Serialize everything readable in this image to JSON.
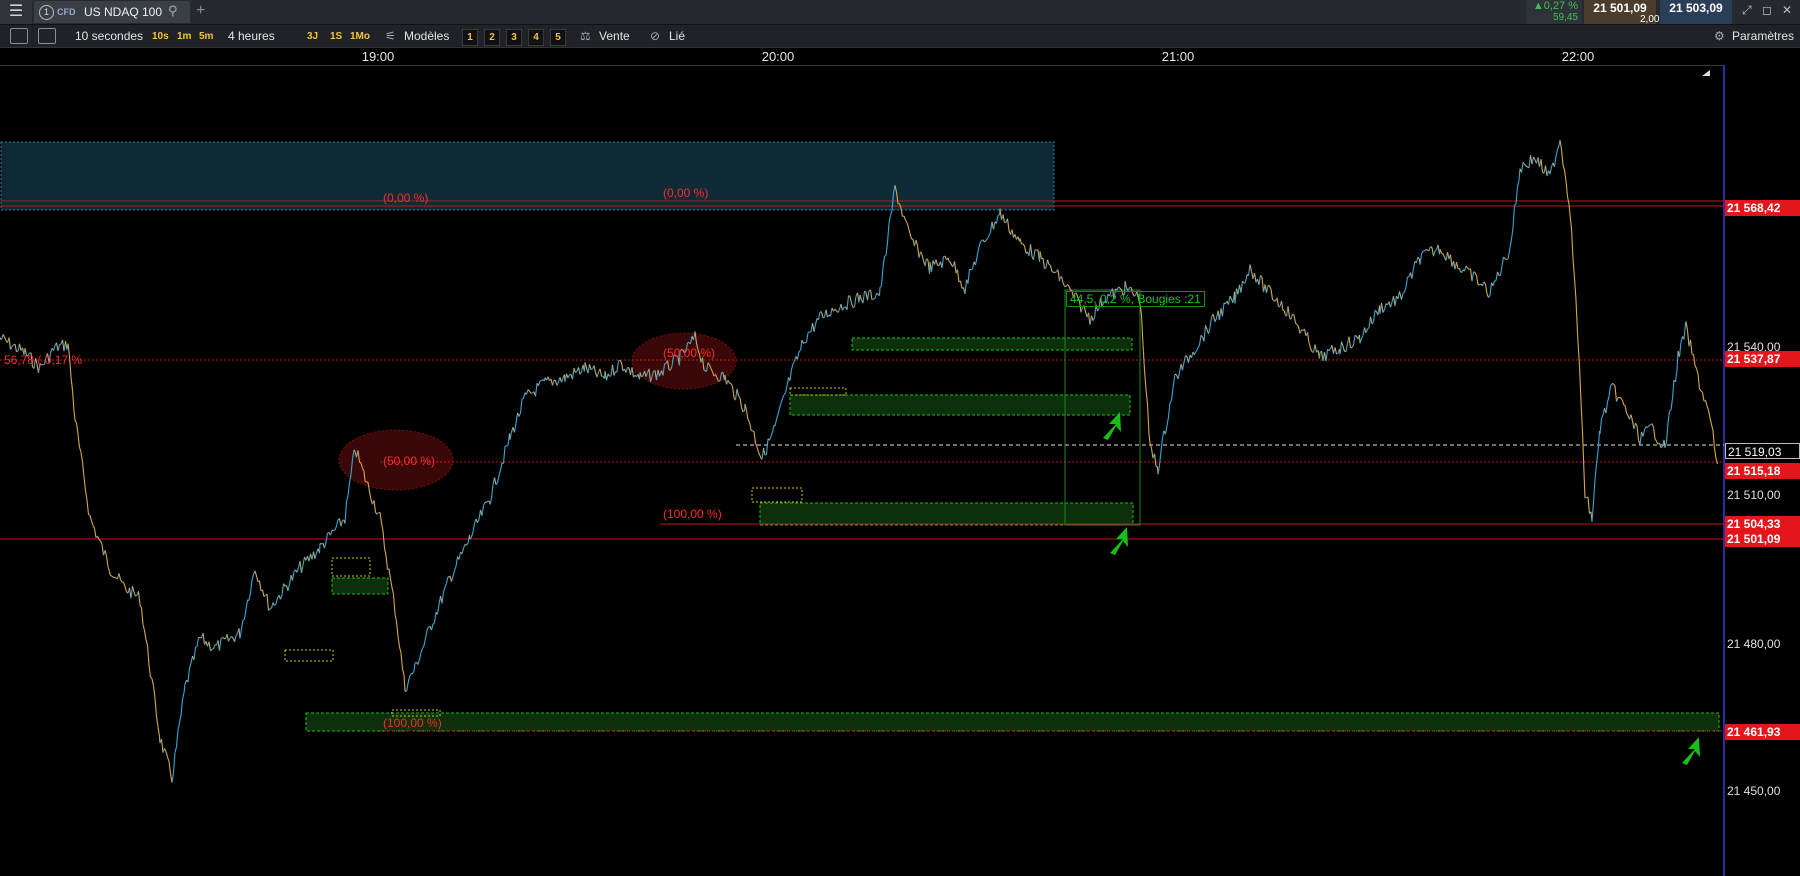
{
  "app": {
    "menu_icon": "hamburger-icon",
    "tab_number": "1",
    "tab_badge": "CFD",
    "instrument": "US NDAQ 100",
    "search_icon": "search-icon",
    "add_tab_icon": "plus-icon"
  },
  "quote": {
    "change_pct": "▲0,27 %",
    "change_abs": "59,45",
    "bid": "21 501,09",
    "ask": "21 503,09",
    "spread": "2,00"
  },
  "toolbar": {
    "interval": "10 secondes",
    "quick_intervals": [
      "10s",
      "1m",
      "5m"
    ],
    "range": "4 heures",
    "quick_ranges": [
      "3J",
      "1S",
      "1Mo"
    ],
    "models_label": "Modèles",
    "layouts": [
      "1",
      "2",
      "3",
      "4",
      "5"
    ],
    "sell_label": "Vente",
    "linked_label": "Lié",
    "settings_label": "Paramètres"
  },
  "time_axis": [
    "19:00",
    "20:00",
    "21:00",
    "22:00"
  ],
  "price_axis": {
    "levels": [
      "21 540,00",
      "21 510,00",
      "21 480,00",
      "21 450,00"
    ],
    "tags": [
      {
        "value": "21 568,42",
        "style": "red"
      },
      {
        "value": "21 537,87",
        "style": "red"
      },
      {
        "value": "21 519,03",
        "style": "white"
      },
      {
        "value": "21 515,18",
        "style": "red"
      },
      {
        "value": "21 504,33",
        "style": "red"
      },
      {
        "value": "21 501,09",
        "style": "red"
      },
      {
        "value": "21 461,93",
        "style": "red"
      }
    ]
  },
  "annotations": {
    "fib_top_left": "(0,00 %)",
    "fib_top_mid": "(0,00 %)",
    "fib_50_left": "(50,00 %)",
    "fib_50_mid": "(50,00 %)",
    "fib_100_mid": "(100,00 %)",
    "fib_100_bottom": "(100,00 %)",
    "left_level": "56,78 ( 0,17 %",
    "measure_box": "44,5, 0,2 %, Bougies :21"
  },
  "colors": {
    "candle_up": "#3aa6d8",
    "candle_down": "#d9a74a",
    "resistance": "#e4161c",
    "support_zone": "#1bbd1b",
    "fvg": "#d8c51c",
    "supply_zone": "#0d2a36"
  }
}
